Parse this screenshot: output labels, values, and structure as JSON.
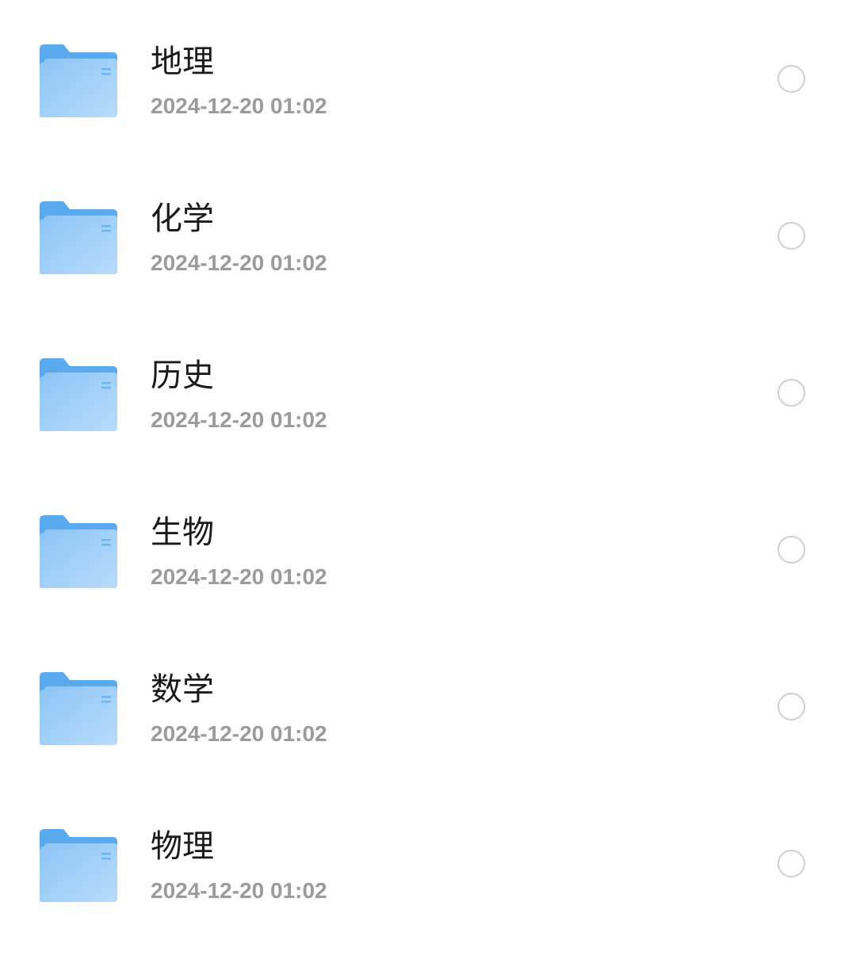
{
  "folders": [
    {
      "name": "地理",
      "modified": "2024-12-20 01:02",
      "selected": false,
      "icon": "folder-icon"
    },
    {
      "name": "化学",
      "modified": "2024-12-20 01:02",
      "selected": false,
      "icon": "folder-icon"
    },
    {
      "name": "历史",
      "modified": "2024-12-20 01:02",
      "selected": false,
      "icon": "folder-icon"
    },
    {
      "name": "生物",
      "modified": "2024-12-20 01:02",
      "selected": false,
      "icon": "folder-icon"
    },
    {
      "name": "数学",
      "modified": "2024-12-20 01:02",
      "selected": false,
      "icon": "folder-icon"
    },
    {
      "name": "物理",
      "modified": "2024-12-20 01:02",
      "selected": false,
      "icon": "folder-icon"
    }
  ],
  "colors": {
    "folder_back": "#5aaaf0",
    "folder_front_top": "#8cc4f6",
    "folder_front_bottom": "#b5dafb",
    "name_text": "#1a1a1a",
    "date_text": "#9b9b9b",
    "checkbox_border": "#cfcfcf"
  }
}
